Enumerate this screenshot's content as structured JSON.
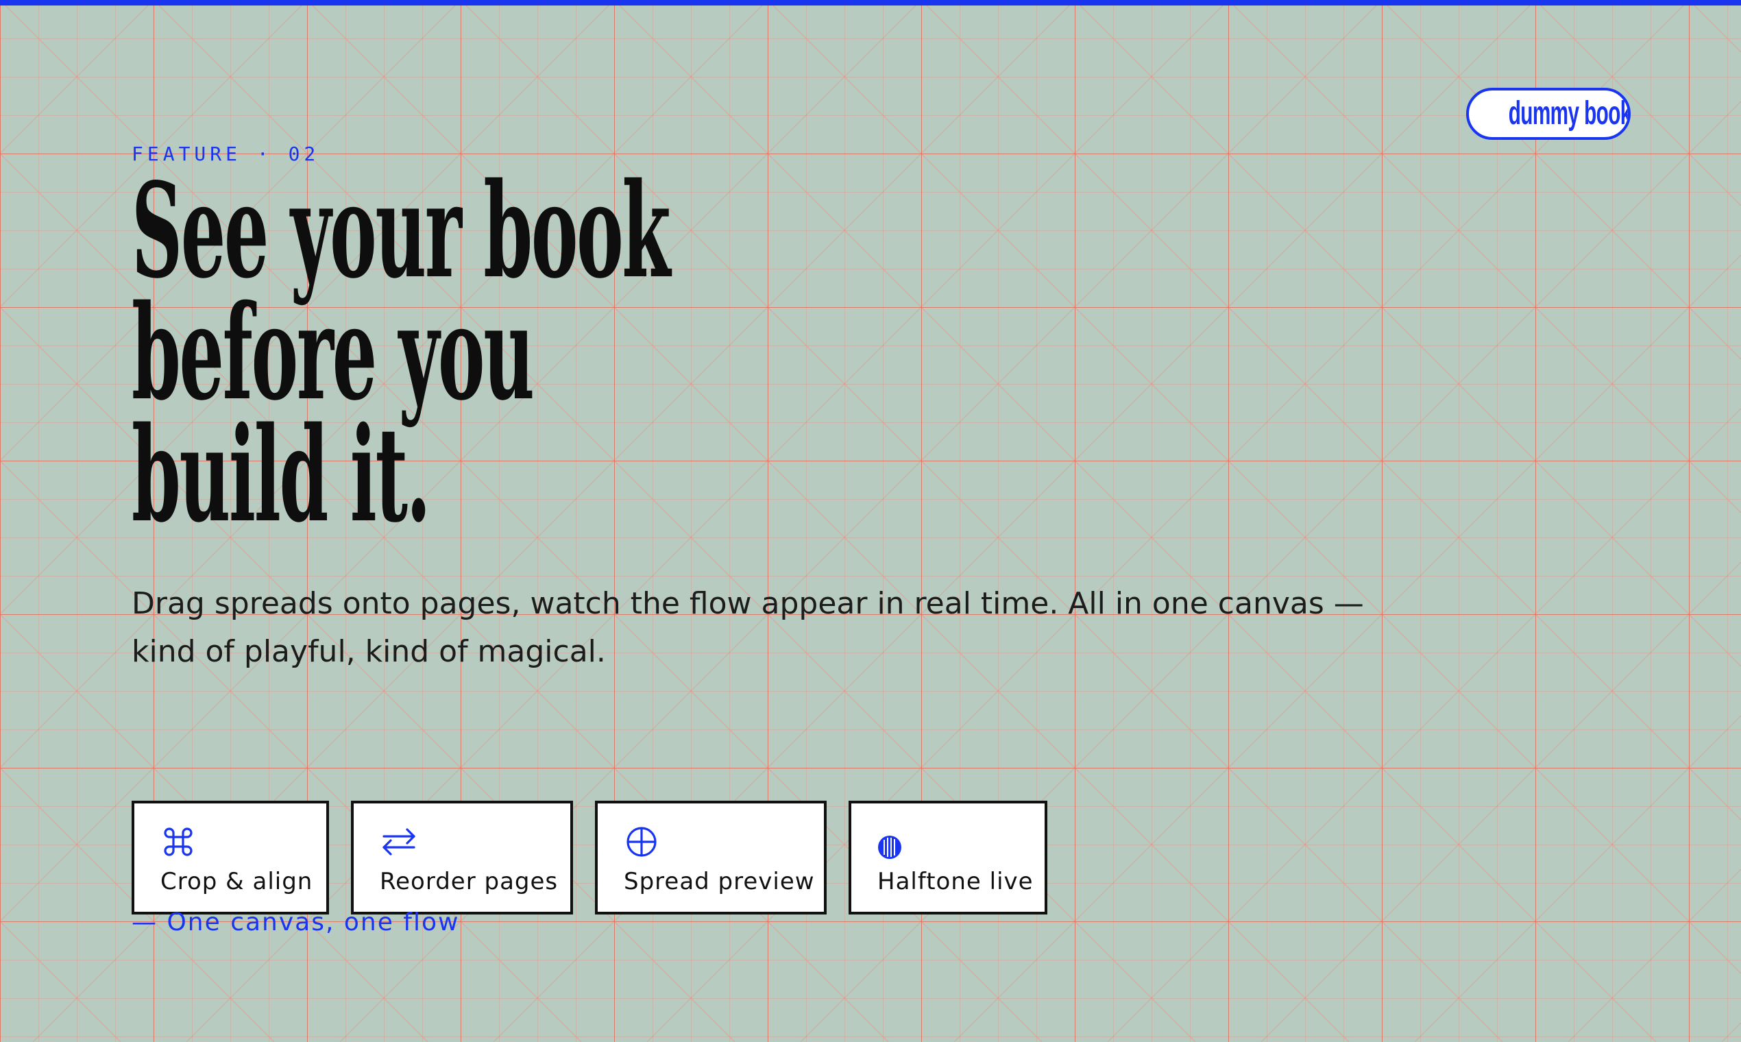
{
  "brand": {
    "label": "dummy book!"
  },
  "feature": {
    "eyebrow": "FEATURE · 02",
    "headline_lines": [
      "See your book",
      "before you",
      "build it."
    ],
    "body_line_1": "Drag spreads onto pages, watch the flow appear in real time. All in one canvas —",
    "body_line_2": "kind of playful, kind of magical.",
    "tagline": "— One canvas, one flow"
  },
  "cards": [
    {
      "label": "Crop & align",
      "icon": "command-icon"
    },
    {
      "label": "Reorder pages",
      "icon": "swap-arrows-icon"
    },
    {
      "label": "Spread preview",
      "icon": "crosshair-circle-icon"
    },
    {
      "label": "Halftone live",
      "icon": "halftone-dot-icon"
    }
  ],
  "colors": {
    "background": "#b8cbc0",
    "grid_lines": "#e07a68",
    "accent": "#1a35f0",
    "text": "#141414",
    "card_bg": "#ffffff"
  }
}
